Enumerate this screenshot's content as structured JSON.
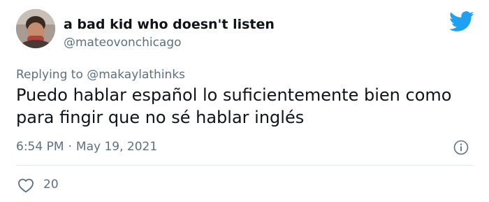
{
  "tweet": {
    "display_name": "a bad kid who doesn't listen",
    "handle": "@mateovonchicago",
    "replying_prefix": "Replying to",
    "replying_to": "@makaylathinks",
    "text": "Puedo hablar español lo suficientemente bien como para fingir que no sé hablar inglés",
    "time": "6:54 PM",
    "separator": "·",
    "date": "May 19, 2021",
    "like_count": "20"
  },
  "icons": {
    "brand": "twitter-bird-icon",
    "info": "info-icon",
    "like": "heart-icon"
  },
  "colors": {
    "brand": "#1da1f2",
    "secondary_text": "#5b7083",
    "primary_text": "#0f1419",
    "divider": "#e1e8ed"
  }
}
